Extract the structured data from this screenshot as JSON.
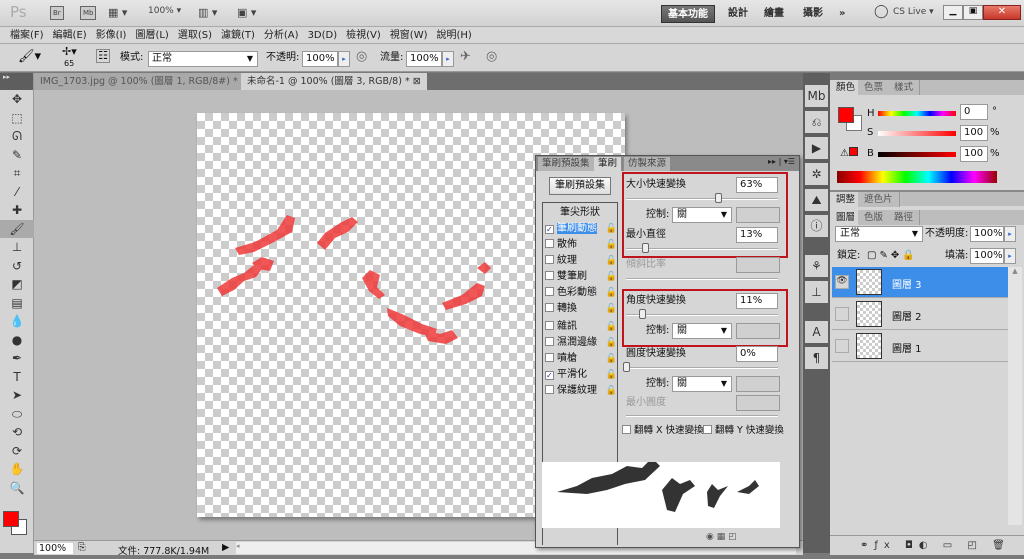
{
  "titlebar": {
    "logo": "Ps",
    "bridge": "Br",
    "minibridge": "Mb",
    "zoom": "100%",
    "workspaces": [
      "基本功能",
      "設計",
      "繪畫",
      "攝影"
    ],
    "more": "»",
    "cslive": "CS Live ▾"
  },
  "menu": [
    "檔案(F)",
    "編輯(E)",
    "影像(I)",
    "圖層(L)",
    "選取(S)",
    "濾鏡(T)",
    "分析(A)",
    "3D(D)",
    "檢視(V)",
    "視窗(W)",
    "說明(H)"
  ],
  "options": {
    "brush_size": "65",
    "mode_label": "模式:",
    "mode_value": "正常",
    "opacity_label": "不透明:",
    "opacity_value": "100%",
    "flow_label": "流量:",
    "flow_value": "100%"
  },
  "doc_tabs": [
    {
      "label": "IMG_1703.jpg @ 100% (圖層 1, RGB/8#) *",
      "close": "⊠"
    },
    {
      "label": "未命名-1 @ 100% (圖層 3, RGB/8) *",
      "close": "⊠"
    }
  ],
  "tools": [
    [
      "move-tool-icon",
      "✥"
    ],
    [
      "marquee-tool-icon",
      "⬚"
    ],
    [
      "lasso-tool-icon",
      "ᘏ"
    ],
    [
      "quick-select-tool-icon",
      "✎"
    ],
    [
      "crop-tool-icon",
      "⌗"
    ],
    [
      "eyedropper-tool-icon",
      "⁄"
    ],
    [
      "healing-brush-icon",
      "✚"
    ],
    [
      "brush-tool-icon",
      "🖌"
    ],
    [
      "clone-stamp-icon",
      "⊥"
    ],
    [
      "history-brush-icon",
      "↺"
    ],
    [
      "eraser-tool-icon",
      "◩"
    ],
    [
      "gradient-tool-icon",
      "▤"
    ],
    [
      "blur-tool-icon",
      "💧"
    ],
    [
      "dodge-tool-icon",
      "●"
    ],
    [
      "pen-tool-icon",
      "✒"
    ],
    [
      "type-tool-icon",
      "T"
    ],
    [
      "path-select-icon",
      "➤"
    ],
    [
      "shape-tool-icon",
      "⬭"
    ],
    [
      "3d-rotate-icon",
      "⟲"
    ],
    [
      "3d-orbit-icon",
      "⟳"
    ],
    [
      "hand-tool-icon",
      "✋"
    ],
    [
      "zoom-tool-icon",
      "🔍"
    ]
  ],
  "colors": {
    "foreground": "#ff0000",
    "background": "#ffffff",
    "accent": "#3d8ee9",
    "highlight": "#c0141c"
  },
  "status": {
    "zoom": "100%",
    "doc_size": "文件: 777.8K/1.94M"
  },
  "brush_panel": {
    "tabs": [
      "筆刷預設集",
      "筆刷",
      "仿製來源"
    ],
    "preset_button": "筆刷預設集",
    "tip_shape": "筆尖形狀",
    "items": [
      {
        "label": "筆刷動態",
        "checked": true,
        "active": true
      },
      {
        "label": "散佈",
        "checked": false
      },
      {
        "label": "紋理",
        "checked": false
      },
      {
        "label": "雙筆刷",
        "checked": false
      },
      {
        "label": "色彩動態",
        "checked": false
      },
      {
        "label": "轉換",
        "checked": false
      },
      {
        "label": "雜訊",
        "checked": false
      },
      {
        "label": "濕潤邊緣",
        "checked": false
      },
      {
        "label": "噴槍",
        "checked": false
      },
      {
        "label": "平滑化",
        "checked": true
      },
      {
        "label": "保護紋理",
        "checked": false
      }
    ],
    "size_jitter_label": "大小快速變換",
    "size_jitter": "63%",
    "size_jitter_value": 63,
    "control_label": "控制:",
    "control_value": "關",
    "min_diameter_label": "最小直徑",
    "min_diameter": "13%",
    "min_diameter_value": 13,
    "tilt_scale_label": "傾斜比率",
    "angle_jitter_label": "角度快速變換",
    "angle_jitter": "11%",
    "angle_jitter_value": 11,
    "roundness_jitter_label": "圓度快速變換",
    "roundness_jitter": "0%",
    "roundness_jitter_value": 0,
    "min_roundness_label": "最小圓度",
    "flip_x": "翻轉 X 快速變換",
    "flip_y": "翻轉 Y 快速變換"
  },
  "color_panel": {
    "tabs": [
      "顏色",
      "色票",
      "樣式"
    ],
    "h_label": "H",
    "h": "0",
    "h_unit": "°",
    "s_label": "S",
    "s": "100",
    "s_unit": "%",
    "b_label": "B",
    "b": "100",
    "b_unit": "%"
  },
  "adjust_panel": {
    "tabs": [
      "調整",
      "遮色片"
    ]
  },
  "layers_panel": {
    "tabs": [
      "圖層",
      "色版",
      "路徑"
    ],
    "blend": "正常",
    "opacity_label": "不透明度:",
    "opacity": "100%",
    "lock_label": "鎖定:",
    "fill_label": "填滿:",
    "fill": "100%",
    "layers": [
      {
        "name": "圖層 3",
        "selected": true,
        "visible": true
      },
      {
        "name": "圖層 2",
        "selected": false,
        "visible": false
      },
      {
        "name": "圖層 1",
        "selected": false,
        "visible": false
      }
    ]
  }
}
